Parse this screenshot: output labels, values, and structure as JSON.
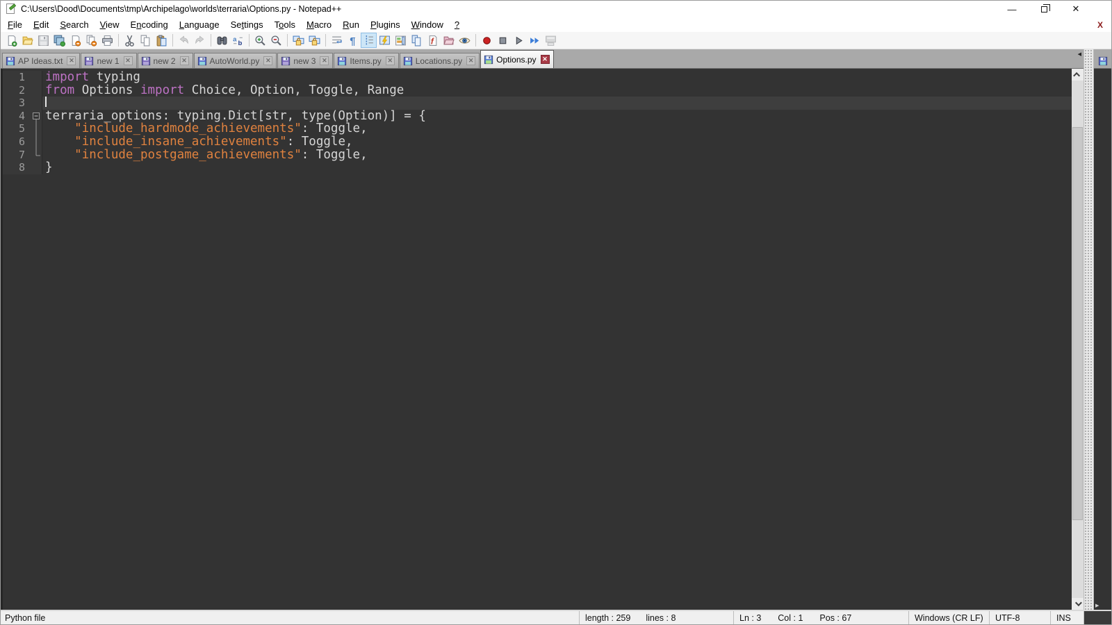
{
  "window": {
    "title": "C:\\Users\\Dood\\Documents\\tmp\\Archipelago\\worlds\\terraria\\Options.py - Notepad++",
    "controls": {
      "minimize": "–",
      "restore": "restore",
      "close": "✕"
    }
  },
  "menu": {
    "items": [
      {
        "label": "File",
        "accel": 0
      },
      {
        "label": "Edit",
        "accel": 0
      },
      {
        "label": "Search",
        "accel": 0
      },
      {
        "label": "View",
        "accel": 0
      },
      {
        "label": "Encoding",
        "accel": 1
      },
      {
        "label": "Language",
        "accel": 0
      },
      {
        "label": "Settings",
        "accel": 2
      },
      {
        "label": "Tools",
        "accel": 1
      },
      {
        "label": "Macro",
        "accel": 0
      },
      {
        "label": "Run",
        "accel": 0
      },
      {
        "label": "Plugins",
        "accel": 0
      },
      {
        "label": "Window",
        "accel": 0
      },
      {
        "label": "?",
        "accel": 0
      }
    ],
    "close_document_label": "X"
  },
  "toolbar": {
    "icons": [
      {
        "name": "new-file"
      },
      {
        "name": "open-file"
      },
      {
        "name": "save-file",
        "disabled": true
      },
      {
        "name": "save-all"
      },
      {
        "name": "close-file"
      },
      {
        "name": "close-all"
      },
      {
        "name": "print"
      },
      {
        "sep": true
      },
      {
        "name": "cut"
      },
      {
        "name": "copy"
      },
      {
        "name": "paste"
      },
      {
        "sep": true
      },
      {
        "name": "undo",
        "disabled": true
      },
      {
        "name": "redo",
        "disabled": true
      },
      {
        "sep": true
      },
      {
        "name": "find"
      },
      {
        "name": "replace"
      },
      {
        "sep": true
      },
      {
        "name": "zoom-in"
      },
      {
        "name": "zoom-out"
      },
      {
        "sep": true
      },
      {
        "name": "sync-vertical"
      },
      {
        "name": "sync-horizontal"
      },
      {
        "sep": true
      },
      {
        "name": "word-wrap"
      },
      {
        "name": "show-all-characters"
      },
      {
        "name": "show-indent-guide",
        "pressed": true
      },
      {
        "name": "function-completion"
      },
      {
        "name": "document-map"
      },
      {
        "name": "document-switcher"
      },
      {
        "name": "function-list"
      },
      {
        "name": "folder-as-workspace"
      },
      {
        "name": "monitoring"
      },
      {
        "sep": true
      },
      {
        "name": "macro-record"
      },
      {
        "name": "macro-stop"
      },
      {
        "name": "macro-play"
      },
      {
        "name": "macro-run-multiple"
      },
      {
        "name": "macro-save",
        "disabled": true
      }
    ]
  },
  "tabs": [
    {
      "label": "AP Ideas.txt",
      "icon": "blue"
    },
    {
      "label": "new 1",
      "icon": "purple"
    },
    {
      "label": "new 2",
      "icon": "purple"
    },
    {
      "label": "AutoWorld.py",
      "icon": "blue"
    },
    {
      "label": "new 3",
      "icon": "purple"
    },
    {
      "label": "Items.py",
      "icon": "blue"
    },
    {
      "label": "Locations.py",
      "icon": "blue"
    },
    {
      "label": "Options.py",
      "icon": "active",
      "active": true
    }
  ],
  "editor": {
    "lines": [
      {
        "num": "1",
        "fold": "",
        "tokens": [
          {
            "c": "kw",
            "t": "import"
          },
          {
            "c": "def",
            "t": " typing"
          }
        ]
      },
      {
        "num": "2",
        "fold": "",
        "tokens": [
          {
            "c": "kw",
            "t": "from"
          },
          {
            "c": "def",
            "t": " Options "
          },
          {
            "c": "kw",
            "t": "import"
          },
          {
            "c": "def",
            "t": " Choice, Option, Toggle, Range"
          }
        ]
      },
      {
        "num": "3",
        "fold": "",
        "caret": true,
        "current": true,
        "tokens": []
      },
      {
        "num": "4",
        "fold": "box",
        "tokens": [
          {
            "c": "def",
            "t": "terraria_options: typing.Dict[str, type(Option)] = {"
          }
        ]
      },
      {
        "num": "5",
        "fold": "line",
        "tokens": [
          {
            "c": "def",
            "t": "    "
          },
          {
            "c": "str",
            "t": "\"include_hardmode_achievements\""
          },
          {
            "c": "def",
            "t": ": Toggle,"
          }
        ]
      },
      {
        "num": "6",
        "fold": "line",
        "tokens": [
          {
            "c": "def",
            "t": "    "
          },
          {
            "c": "str",
            "t": "\"include_insane_achievements\""
          },
          {
            "c": "def",
            "t": ": Toggle,"
          }
        ]
      },
      {
        "num": "7",
        "fold": "end",
        "tokens": [
          {
            "c": "def",
            "t": "    "
          },
          {
            "c": "str",
            "t": "\"include_postgame_achievements\""
          },
          {
            "c": "def",
            "t": ": Toggle,"
          }
        ]
      },
      {
        "num": "8",
        "fold": "",
        "tokens": [
          {
            "c": "def",
            "t": "}"
          }
        ]
      }
    ],
    "colors": {
      "background": "#333333",
      "keyword": "#bd72c4",
      "string": "#e0823f",
      "default_text": "#d6d6d6",
      "line_number": "#9b9b9b"
    }
  },
  "status": {
    "doc_type": "Python file",
    "length": "length : 259",
    "lines": "lines : 8",
    "line": "Ln : 3",
    "column": "Col : 1",
    "position": "Pos : 67",
    "eol": "Windows (CR LF)",
    "encoding": "UTF-8",
    "insert_mode": "INS"
  }
}
